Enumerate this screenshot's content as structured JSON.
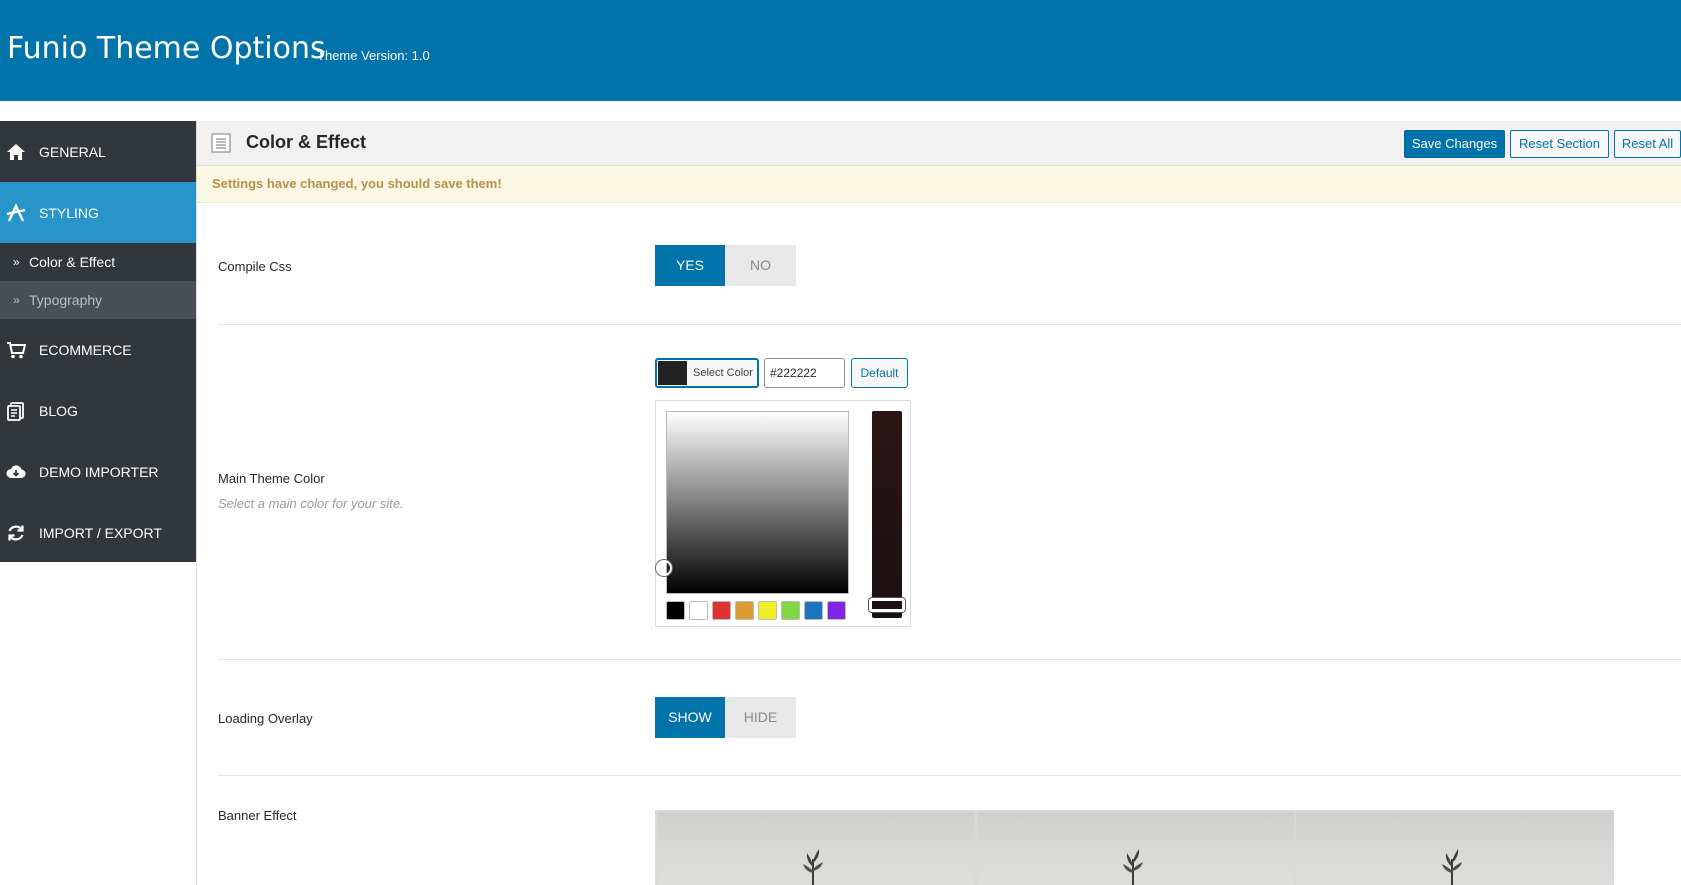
{
  "header": {
    "title": "Funio Theme Options",
    "version": "Theme Version: 1.0"
  },
  "sidebar": {
    "items": [
      {
        "label": "GENERAL",
        "icon": "home-icon"
      },
      {
        "label": "STYLING",
        "icon": "styling-icon",
        "active": true
      },
      {
        "label": "ECOMMERCE",
        "icon": "cart-icon"
      },
      {
        "label": "BLOG",
        "icon": "blog-icon"
      },
      {
        "label": "DEMO IMPORTER",
        "icon": "cloud-download-icon"
      },
      {
        "label": "IMPORT / EXPORT",
        "icon": "refresh-icon"
      }
    ],
    "subitems": [
      {
        "label": "Color & Effect",
        "active": true
      },
      {
        "label": "Typography",
        "active": false
      }
    ]
  },
  "section": {
    "title": "Color & Effect",
    "save_label": "Save Changes",
    "reset_section_label": "Reset Section",
    "reset_all_label": "Reset All"
  },
  "notice": {
    "text": "Settings have changed, you should save them!"
  },
  "fields": {
    "compile_css": {
      "label": "Compile Css",
      "on": "YES",
      "off": "NO",
      "selected": "YES"
    },
    "main_color": {
      "label": "Main Theme Color",
      "description": "Select a main color for your site.",
      "select_label": "Select Color",
      "value": "#222222",
      "default_label": "Default",
      "swatches": [
        "#000000",
        "#ffffff",
        "#dd3333",
        "#dd9933",
        "#eeee22",
        "#81d742",
        "#1e73be",
        "#8224e3"
      ]
    },
    "loading_overlay": {
      "label": "Loading Overlay",
      "on": "SHOW",
      "off": "HIDE",
      "selected": "SHOW"
    },
    "banner_effect": {
      "label": "Banner Effect"
    }
  },
  "colors": {
    "header_bg": "#0073aa",
    "sidebar_bg": "#32373c",
    "sidebar_active": "#2795c9",
    "notice_bg": "#fcf7e3",
    "notice_text": "#b59150"
  }
}
